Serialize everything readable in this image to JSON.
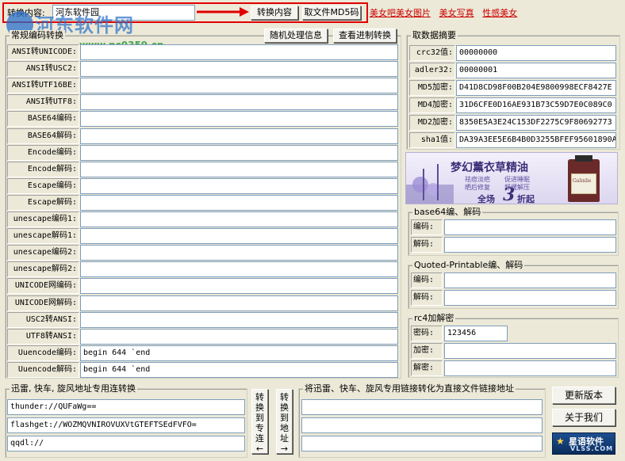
{
  "top": {
    "label": "转换内容:",
    "input_value": "河东软件园",
    "convert_button": "转换内容",
    "md5_button": "取文件MD5码",
    "ads": [
      "美女吧美女图片",
      "美女写真",
      "性感美女"
    ]
  },
  "watermark": {
    "site_name": "河东软件网",
    "url": "www.pc0359.cn"
  },
  "encode": {
    "title": "常规编码转换",
    "random_button": "随机处理信息",
    "hex_button": "查看进制转换",
    "rows": [
      {
        "label": "ANSI转UNICODE:",
        "value": ""
      },
      {
        "label": "ANSI转USC2:",
        "value": ""
      },
      {
        "label": "ANSI转UTF16BE:",
        "value": ""
      },
      {
        "label": "ANSI转UTF8:",
        "value": ""
      },
      {
        "label": "BASE64编码:",
        "value": ""
      },
      {
        "label": "BASE64解码:",
        "value": ""
      },
      {
        "label": "Encode编码:",
        "value": ""
      },
      {
        "label": "Encode解码:",
        "value": ""
      },
      {
        "label": "Escape编码:",
        "value": ""
      },
      {
        "label": "Escape解码:",
        "value": ""
      },
      {
        "label": "unescape编码1:",
        "value": ""
      },
      {
        "label": "unescape解码1:",
        "value": ""
      },
      {
        "label": "unescape编码2:",
        "value": ""
      },
      {
        "label": "unescape解码2:",
        "value": ""
      },
      {
        "label": "UNICODE网编码:",
        "value": ""
      },
      {
        "label": "UNICODE网解码:",
        "value": ""
      },
      {
        "label": "USC2转ANSI:",
        "value": ""
      },
      {
        "label": "UTF8转ANSI:",
        "value": ""
      },
      {
        "label": "Uuencode编码:",
        "value": "begin 644 `end"
      },
      {
        "label": "Uuencode解码:",
        "value": "begin 644 `end"
      }
    ]
  },
  "digest": {
    "title": "取数据摘要",
    "rows": [
      {
        "label": "crc32值:",
        "value": "00000000"
      },
      {
        "label": "adler32:",
        "value": "00000001"
      },
      {
        "label": "MD5加密:",
        "value": "D41D8CD98F00B204E9800998ECF8427E"
      },
      {
        "label": "MD4加密:",
        "value": "31D6CFE0D16AE931B73C59D7E0C089C0"
      },
      {
        "label": "MD2加密:",
        "value": "8350E5A3E24C153DF2275C9F80692773"
      },
      {
        "label": "sha1值:",
        "value": "DA39A3EE5E6B4B0D3255BFEF95601890A"
      }
    ]
  },
  "banner": {
    "headline": "梦幻薰衣草精油",
    "sub1": "祛痘淡疤",
    "sub2": "促进睡眠",
    "sub3": "晒后修复",
    "sub4": "舒缓解压",
    "promo_prefix": "全场",
    "promo_number": "3",
    "promo_suffix": "折起",
    "bottle_brand": "Galinlie"
  },
  "base64": {
    "title": "base64编、解码",
    "encode_label": "编码:",
    "decode_label": "解码:",
    "encode_value": "",
    "decode_value": ""
  },
  "qp": {
    "title": "Quoted-Printable编、解码",
    "encode_label": "编码:",
    "decode_label": "解码:",
    "encode_value": "",
    "decode_value": ""
  },
  "rc4": {
    "title": "rc4加解密",
    "key_label": "密码:",
    "key_value": "123456",
    "encrypt_label": "加密:",
    "decrypt_label": "解密:",
    "encrypt_value": "",
    "decrypt_value": ""
  },
  "links": {
    "title": "迅雷, 快车, 旋风地址专用连转换",
    "thunder": "thunder://QUFaWg==",
    "flashget": "flashget://WOZMQVNIROVUXVtGTEFTSEdFVFO=",
    "qqdl": "qqdl://",
    "to_special_button": [
      "转",
      "换",
      "到",
      "专",
      "连",
      "←"
    ],
    "to_address_button": [
      "转",
      "换",
      "到",
      "地",
      "址",
      "→"
    ]
  },
  "direct": {
    "title": "将迅雷、快车、旋风专用链接转化为直接文件链接地址",
    "rows": [
      "",
      "",
      ""
    ]
  },
  "actions": {
    "update_button": "更新版本",
    "about_button": "关于我们"
  },
  "logo": {
    "name": "星语软件",
    "domain": "VLSS.COM"
  },
  "colors": {
    "highlight_border": "#e00000",
    "arrow": "#e00000",
    "ad_link": "#cc0000",
    "window_bg": "#ece9d8"
  }
}
